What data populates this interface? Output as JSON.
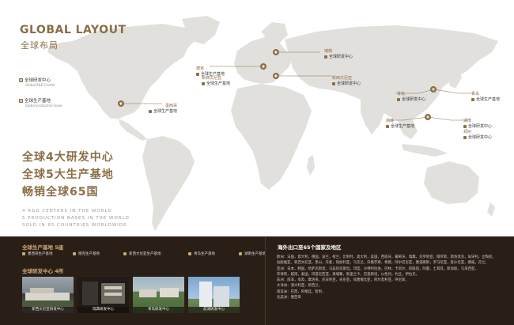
{
  "header": {
    "title_en": "GLOBAL LAYOUT",
    "title_cn": "全球布局"
  },
  "legend": [
    {
      "cn": "全球研发中心",
      "en": "Global R&D Center"
    },
    {
      "cn": "全球生产基地",
      "en": "Global production base"
    }
  ],
  "headline": [
    "全球4大研发中心",
    "全球5大生产基地",
    "畅销全球65国"
  ],
  "headline_en": [
    "4 R&D CENTERS IN THE WORLD",
    "5 PRODUCTION BASES IN THE WORLD",
    "SOLD IN 65 COUNTRIES WORLDWIDE"
  ],
  "map_labels": [
    {
      "city": "瑞典",
      "items": [
        "全球研发中心"
      ]
    },
    {
      "city": "德克",
      "items": [
        "全球生产基地"
      ]
    },
    {
      "city": "新西文尼亚",
      "items": [
        "全球生产基地"
      ]
    },
    {
      "city": "新西文尼亚",
      "items": [
        "全球研发中心"
      ]
    },
    {
      "city": "墨西哥",
      "items": [
        "全球生产基地"
      ]
    },
    {
      "city": "青岛",
      "items": [
        "全球研发中心"
      ]
    },
    {
      "city": "青岛",
      "items": [
        "全球生产基地"
      ]
    },
    {
      "city": "湖南",
      "items": [
        "全球研发中心"
      ]
    },
    {
      "city": "郑州",
      "items": [
        "全球研发中心"
      ]
    },
    {
      "city": "前滩",
      "items": [
        "全球生产基地"
      ]
    }
  ],
  "production": {
    "title": "全球生产基地",
    "count": "5座",
    "items": [
      "墨西哥生产基地",
      "德克生产基地",
      "新西文尼亚生产基地",
      "青岛生产基地",
      "湖南生产基地"
    ]
  },
  "rnd": {
    "title": "全球研发中心",
    "count": "4所",
    "items": [
      "新西文尼亚研发中心",
      "瑞典研发中心",
      "青岛研发中心",
      "前滩研发中心"
    ]
  },
  "export": {
    "title": "海外出口至65个国家及地区",
    "lines": [
      "欧洲：法国，意大利，德国，波兰，荷兰，比利时，奥大利，美国，西班牙，葡萄牙，瑞典，克罗地亚，俄罗斯，斯洛伐克，匈牙利，立陶宛，",
      "拉脱维亚，新西文尼亚，黑山，丹麦，保加利亚，乌克兰，白俄罗斯，希腊，阿尔巴尼亚，塞浦路斯，罗马尼亚，爱沙尼亚，挪威，芬兰，",
      "亚洲：日本，韩国，哈萨克斯坦，乌兹别克斯坦，印度，沙特阿拉伯，巴林，卡塔尔，阿联酋，阿曼，土耳其，新加坡，马来西亚，",
      "菲律宾，越南，泰国，印度尼西亚，柬埔寨，斯里兰卡，巴基斯坦，以色列，约旦，伊拉克，",
      "非洲：南非，埃及，摩洛哥，尼日利亚，肯尼亚，埃塞俄比亚，阿尔及利亚，突尼斯，",
      "大洋洲：澳大利亚，新西兰，",
      "南美洲：巴西，阿根廷，智利，",
      "北美洲：墨西哥"
    ]
  },
  "colors": {
    "accent": "#8b6d45",
    "dark_band": "#2a1f16",
    "land": "#e2e0dd"
  }
}
